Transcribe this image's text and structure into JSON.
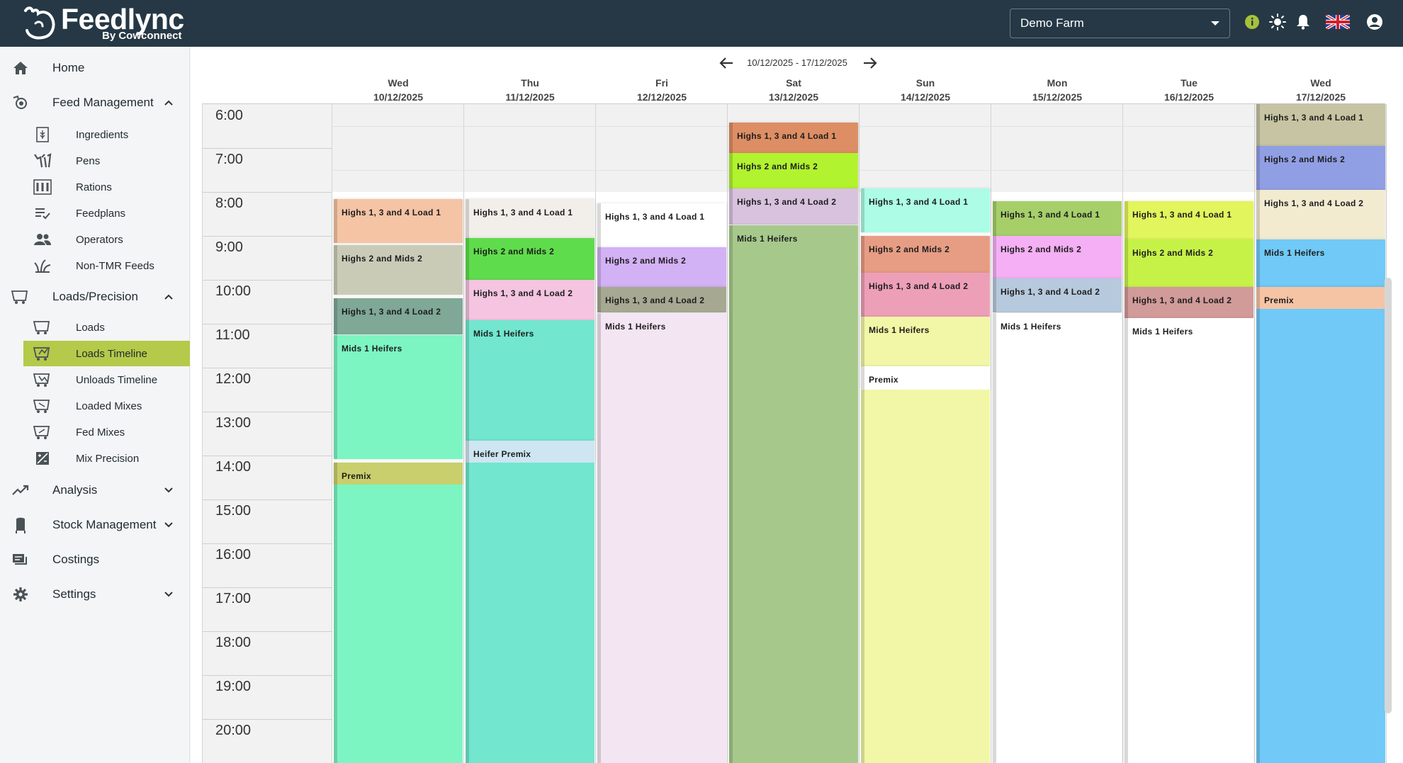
{
  "app": {
    "name": "Feedlync",
    "byline": "By Cowconnect"
  },
  "header": {
    "farm_selected": "Demo Farm",
    "icons": [
      "info-icon",
      "sun-icon",
      "bell-icon",
      "uk-flag-icon",
      "account-icon"
    ],
    "colors": {
      "bar": "#263845",
      "info": "#a6c13a"
    }
  },
  "sidebar": {
    "home": "Home",
    "feed_management": {
      "label": "Feed Management",
      "items": [
        "Ingredients",
        "Pens",
        "Rations",
        "Feedplans",
        "Operators",
        "Non-TMR Feeds"
      ]
    },
    "loads_precision": {
      "label": "Loads/Precision",
      "items": [
        "Loads",
        "Loads Timeline",
        "Unloads Timeline",
        "Loaded Mixes",
        "Fed Mixes",
        "Mix Precision"
      ],
      "active": "Loads Timeline"
    },
    "analysis": "Analysis",
    "stock_management": "Stock Management",
    "costings": "Costings",
    "settings": "Settings",
    "active_color": "#b5c94a"
  },
  "timeline": {
    "range": "10/12/2025 - 17/12/2025",
    "days": [
      {
        "dow": "Wed",
        "date": "10/12/2025"
      },
      {
        "dow": "Thu",
        "date": "11/12/2025"
      },
      {
        "dow": "Fri",
        "date": "12/12/2025"
      },
      {
        "dow": "Sat",
        "date": "13/12/2025"
      },
      {
        "dow": "Sun",
        "date": "14/12/2025"
      },
      {
        "dow": "Mon",
        "date": "15/12/2025"
      },
      {
        "dow": "Tue",
        "date": "16/12/2025"
      },
      {
        "dow": "Wed",
        "date": "17/12/2025"
      }
    ],
    "hours": [
      "6:00",
      "7:00",
      "8:00",
      "9:00",
      "10:00",
      "11:00",
      "12:00",
      "13:00",
      "14:00",
      "15:00",
      "16:00",
      "17:00",
      "18:00",
      "19:00",
      "20:00"
    ],
    "events": [
      {
        "day": 0,
        "start": "8:10",
        "end": "9:10",
        "label": "Highs 1, 3 and 4 Load 1",
        "color": "#f5c4a5"
      },
      {
        "day": 0,
        "start": "9:13",
        "end": "10:20",
        "label": "Highs 2 and Mids 2",
        "color": "#c9cbb7"
      },
      {
        "day": 0,
        "start": "10:25",
        "end": "11:15",
        "label": "Highs 1, 3 and 4 Load 2",
        "color": "#7fa896"
      },
      {
        "day": 0,
        "start": "11:15",
        "end": "14:05",
        "label": "Mids 1 Heifers",
        "color": "#7cf5c3"
      },
      {
        "day": 0,
        "start": "14:10",
        "end": "14:40",
        "label": "Premix",
        "color": "#c9cf6c"
      },
      {
        "day": 0,
        "start": "14:40",
        "end": "21:00",
        "label": "",
        "color": "#7cf5c3"
      },
      {
        "day": 1,
        "start": "8:10",
        "end": "9:03",
        "label": "Highs 1, 3 and 4 Load 1",
        "color": "#f2efeb"
      },
      {
        "day": 1,
        "start": "9:03",
        "end": "10:00",
        "label": "Highs 2 and Mids 2",
        "color": "#5fdc4b"
      },
      {
        "day": 1,
        "start": "10:00",
        "end": "10:55",
        "label": "Highs 1, 3 and 4 Load 2",
        "color": "#f4c4e0"
      },
      {
        "day": 1,
        "start": "10:55",
        "end": "13:40",
        "label": "Mids 1 Heifers",
        "color": "#72e6cf"
      },
      {
        "day": 1,
        "start": "13:40",
        "end": "14:10",
        "label": "Heifer Premix",
        "color": "#cde6f2"
      },
      {
        "day": 1,
        "start": "14:10",
        "end": "21:00",
        "label": "",
        "color": "#72e6cf"
      },
      {
        "day": 2,
        "start": "8:15",
        "end": "9:15",
        "label": "Highs 1, 3 and 4 Load 1",
        "color": "#ffffff"
      },
      {
        "day": 2,
        "start": "9:15",
        "end": "10:10",
        "label": "Highs 2 and Mids 2",
        "color": "#d3b1f5"
      },
      {
        "day": 2,
        "start": "10:10",
        "end": "10:45",
        "label": "Highs 1, 3 and 4 Load 2",
        "color": "#a6a892"
      },
      {
        "day": 2,
        "start": "10:45",
        "end": "21:00",
        "label": "Mids 1 Heifers",
        "color": "#f4e5f2"
      },
      {
        "day": 3,
        "start": "6:25",
        "end": "7:07",
        "label": "Highs 1, 3 and 4 Load 1",
        "color": "#de8e64"
      },
      {
        "day": 3,
        "start": "7:07",
        "end": "7:55",
        "label": "Highs 2 and Mids 2",
        "color": "#b2f32f"
      },
      {
        "day": 3,
        "start": "7:55",
        "end": "8:45",
        "label": "Highs 1, 3 and 4 Load 2",
        "color": "#d8c2de"
      },
      {
        "day": 3,
        "start": "8:45",
        "end": "21:00",
        "label": "Mids 1 Heifers",
        "color": "#a6c98b"
      },
      {
        "day": 4,
        "start": "7:55",
        "end": "8:55",
        "label": "Highs 1, 3 and 4 Load 1",
        "color": "#acfce6"
      },
      {
        "day": 4,
        "start": "9:00",
        "end": "9:50",
        "label": "Highs 2 and Mids 2",
        "color": "#e79d84"
      },
      {
        "day": 4,
        "start": "9:50",
        "end": "10:50",
        "label": "Highs 1, 3 and 4 Load 2",
        "color": "#ee9fb8"
      },
      {
        "day": 4,
        "start": "10:50",
        "end": "11:58",
        "label": "Mids 1 Heifers",
        "color": "#f1f7a6"
      },
      {
        "day": 4,
        "start": "11:58",
        "end": "12:30",
        "label": "Premix",
        "color": "#ffffff"
      },
      {
        "day": 4,
        "start": "12:30",
        "end": "21:00",
        "label": "",
        "color": "#f1f7a6"
      },
      {
        "day": 5,
        "start": "8:13",
        "end": "9:00",
        "label": "Highs 1, 3 and 4 Load 1",
        "color": "#a6cf6a"
      },
      {
        "day": 5,
        "start": "9:00",
        "end": "9:58",
        "label": "Highs 2 and Mids 2",
        "color": "#f5aff4"
      },
      {
        "day": 5,
        "start": "9:58",
        "end": "10:45",
        "label": "Highs 1, 3 and 4 Load 2",
        "color": "#b7c9dd"
      },
      {
        "day": 5,
        "start": "10:45",
        "end": "21:00",
        "label": "Mids 1 Heifers",
        "color": "#ffffff"
      },
      {
        "day": 6,
        "start": "8:13",
        "end": "9:05",
        "label": "Highs 1, 3 and 4 Load 1",
        "color": "#e2f55c"
      },
      {
        "day": 6,
        "start": "9:05",
        "end": "10:10",
        "label": "Highs 2 and Mids 2",
        "color": "#c6f248"
      },
      {
        "day": 6,
        "start": "10:10",
        "end": "10:52",
        "label": "Highs 1, 3 and 4 Load 2",
        "color": "#d19b9a"
      },
      {
        "day": 6,
        "start": "10:52",
        "end": "21:00",
        "label": "Mids 1 Heifers",
        "color": "#ffffff"
      },
      {
        "day": 7,
        "start": "6:00",
        "end": "6:57",
        "label": "Highs 1, 3 and 4 Load 1",
        "color": "#c6c4a2"
      },
      {
        "day": 7,
        "start": "6:57",
        "end": "7:57",
        "label": "Highs 2 and Mids 2",
        "color": "#909fe4"
      },
      {
        "day": 7,
        "start": "7:57",
        "end": "9:05",
        "label": "Highs 1, 3 and 4 Load 2",
        "color": "#f3ebd0"
      },
      {
        "day": 7,
        "start": "9:05",
        "end": "10:10",
        "label": "Mids 1 Heifers",
        "color": "#70c9f6"
      },
      {
        "day": 7,
        "start": "10:10",
        "end": "10:40",
        "label": "Premix",
        "color": "#f5c4a5"
      },
      {
        "day": 7,
        "start": "10:40",
        "end": "21:00",
        "label": "",
        "color": "#70c9f6"
      }
    ]
  }
}
